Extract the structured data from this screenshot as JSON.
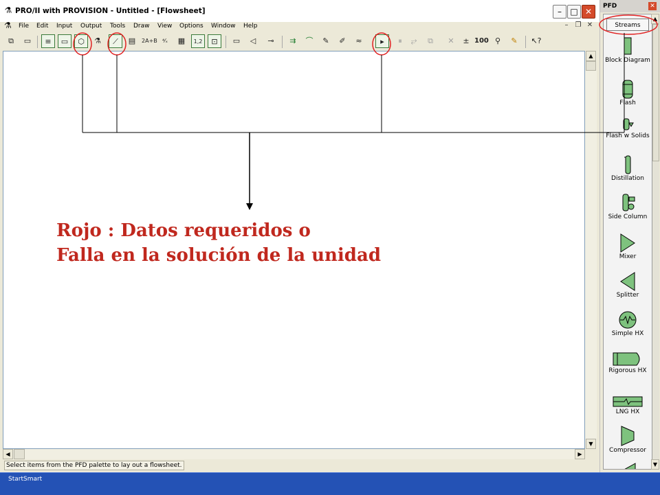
{
  "window": {
    "title": "PRO/II with PROVISION - Untitled - [Flowsheet]",
    "app_icon": "proii-app-icon",
    "buttons": [
      "minimize",
      "maximize",
      "close"
    ]
  },
  "menubar": {
    "items": [
      "File",
      "Edit",
      "Input",
      "Output",
      "Tools",
      "Draw",
      "View",
      "Options",
      "Window",
      "Help"
    ]
  },
  "toolbar": {
    "buttons": [
      {
        "name": "new-flowsheet-icon",
        "glyph": "⧉"
      },
      {
        "name": "save-icon",
        "glyph": "▭"
      },
      {
        "name": "problem-description-icon",
        "glyph": "≡"
      },
      {
        "name": "units-of-measure-icon",
        "glyph": "▭"
      },
      {
        "name": "thermodynamic-methods-icon",
        "glyph": "⬡"
      },
      {
        "name": "component-selection-icon",
        "glyph": "⚗"
      },
      {
        "name": "component-properties-icon",
        "glyph": "⟋"
      },
      {
        "name": "assay-data-icon",
        "glyph": "▤"
      },
      {
        "name": "reaction-data-icon",
        "glyph": "2A+B"
      },
      {
        "name": "stoichiometry-icon",
        "glyph": "⁴⁄ₓ"
      },
      {
        "name": "procedure-data-icon",
        "glyph": "▦"
      },
      {
        "name": "calculation-sequence-icon",
        "glyph": "1,2"
      },
      {
        "name": "recycle-convergence-icon",
        "glyph": "⊡"
      },
      {
        "name": "window-icon",
        "glyph": "▭"
      },
      {
        "name": "add-stream-icon",
        "glyph": "◁"
      },
      {
        "name": "connector-icon",
        "glyph": "⊸"
      },
      {
        "name": "run-simulation-icon",
        "glyph": "⇉"
      },
      {
        "name": "plot-icon",
        "glyph": "⌒"
      },
      {
        "name": "edit-icon",
        "glyph": "✎"
      },
      {
        "name": "tag-icon",
        "glyph": "✐"
      },
      {
        "name": "wave-icon",
        "glyph": "≈"
      },
      {
        "name": "run-icon",
        "glyph": "▸"
      },
      {
        "name": "pause-icon",
        "glyph": "⏸"
      },
      {
        "name": "step-icon",
        "glyph": "⥂"
      },
      {
        "name": "stop-icon",
        "glyph": "⧉"
      },
      {
        "name": "delete-icon",
        "glyph": "✕"
      },
      {
        "name": "spinner-icon",
        "glyph": "±"
      },
      {
        "name": "zoom-100-icon",
        "glyph": "100"
      },
      {
        "name": "zoom-icon",
        "glyph": "⚲"
      },
      {
        "name": "highlight-icon",
        "glyph": "✎"
      },
      {
        "name": "help-pointer-icon",
        "glyph": "↖?"
      }
    ]
  },
  "annotation": {
    "line1": "Rojo : Datos requeridos o",
    "line2": "Falla en la solución de la unidad",
    "color": "#c0281e"
  },
  "status": {
    "text": "Select items from the PFD palette to lay out a flowsheet."
  },
  "taskbar": {
    "label": "StartSmart"
  },
  "pfd": {
    "title": "PFD",
    "streams_label": "Streams",
    "items": [
      {
        "label": "Block Diagram",
        "icon": "block-diagram-icon"
      },
      {
        "label": "Flash",
        "icon": "flash-icon"
      },
      {
        "label": "Flash w Solids",
        "icon": "flash-solids-icon"
      },
      {
        "label": "Distillation",
        "icon": "distillation-icon"
      },
      {
        "label": "Side Column",
        "icon": "side-column-icon"
      },
      {
        "label": "Mixer",
        "icon": "mixer-icon"
      },
      {
        "label": "Splitter",
        "icon": "splitter-icon"
      },
      {
        "label": "Simple HX",
        "icon": "simple-hx-icon"
      },
      {
        "label": "Rigorous HX",
        "icon": "rigorous-hx-icon"
      },
      {
        "label": "LNG HX",
        "icon": "lng-hx-icon"
      },
      {
        "label": "Compressor",
        "icon": "compressor-icon"
      }
    ]
  },
  "colors": {
    "highlight_red": "#e02020",
    "palette_green": "#3a7a3a",
    "taskbar_blue": "#2452b5"
  }
}
